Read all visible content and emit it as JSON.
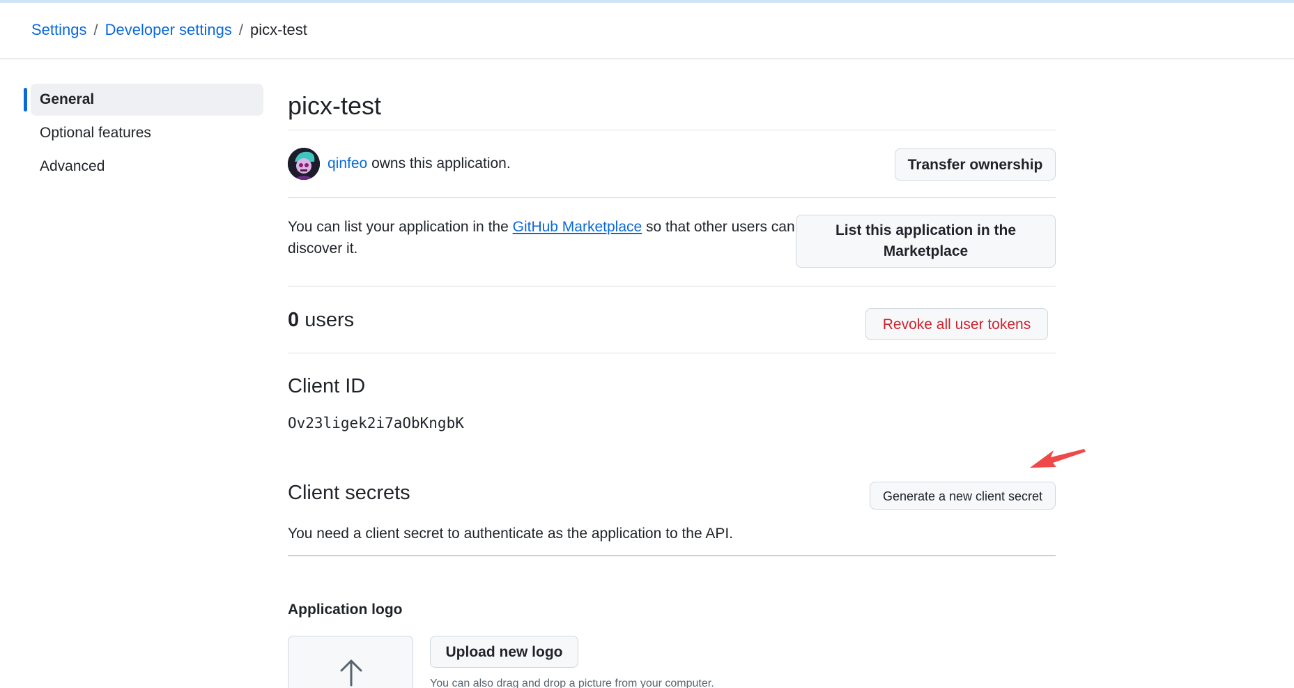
{
  "breadcrumb": {
    "settings": "Settings",
    "developer_settings": "Developer settings",
    "current": "picx-test",
    "separator": "/"
  },
  "sidebar": {
    "items": [
      {
        "label": "General",
        "active": true
      },
      {
        "label": "Optional features",
        "active": false
      },
      {
        "label": "Advanced",
        "active": false
      }
    ]
  },
  "app": {
    "title": "picx-test",
    "owner": {
      "username": "qinfeo",
      "suffix": "owns this application."
    },
    "transfer_button": "Transfer ownership",
    "marketplace": {
      "text_before": "You can list your application in the",
      "link": "GitHub Marketplace",
      "text_after": "so that other users can discover it.",
      "button": "List this application in the Marketplace"
    },
    "users": {
      "count": "0",
      "label": "users",
      "revoke_button": "Revoke all user tokens"
    },
    "client_id": {
      "heading": "Client ID",
      "value": "Ov23ligek2i7aObKngbK"
    },
    "client_secrets": {
      "heading": "Client secrets",
      "generate_button": "Generate a new client secret",
      "description": "You need a client secret to authenticate as the application to the API."
    },
    "logo": {
      "heading": "Application logo",
      "upload_button": "Upload new logo",
      "hint": "You can also drag and drop a picture from your computer."
    }
  },
  "colors": {
    "link": "#0969da",
    "danger": "#cf222e",
    "active_indicator": "#0969da",
    "annotation_arrow": "#f04848"
  },
  "icons": {
    "upload": "upload-arrow-icon",
    "annotation": "red-arrow-annotation"
  }
}
